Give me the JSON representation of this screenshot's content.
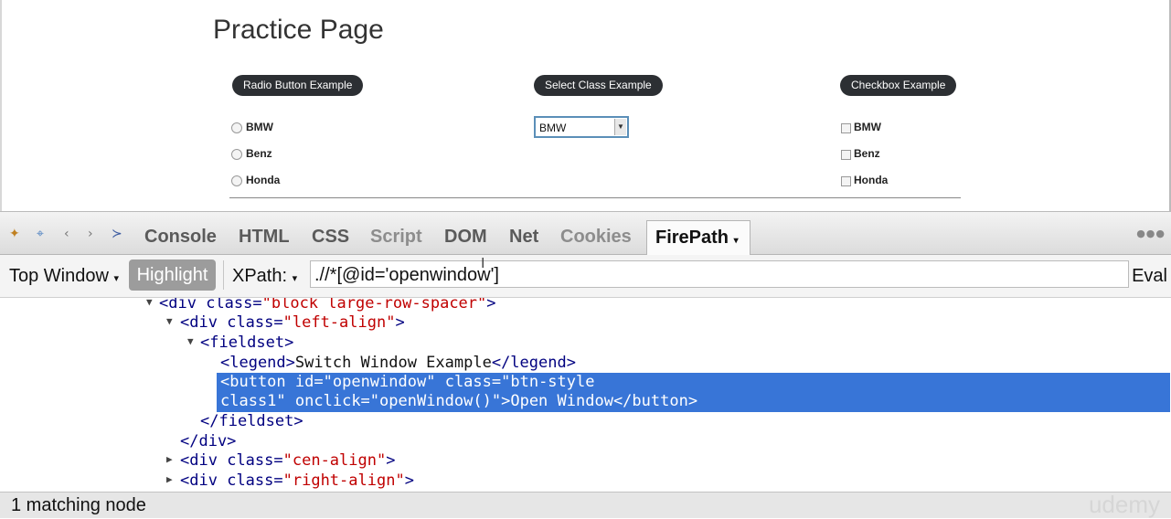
{
  "page": {
    "title": "Practice Page",
    "radio": {
      "label": "Radio Button Example",
      "options": [
        "BMW",
        "Benz",
        "Honda"
      ]
    },
    "select": {
      "label": "Select Class Example",
      "value": "BMW"
    },
    "checkbox": {
      "label": "Checkbox Example",
      "options": [
        "BMW",
        "Benz",
        "Honda"
      ]
    }
  },
  "devtools": {
    "tabs": [
      "Console",
      "HTML",
      "CSS",
      "Script",
      "DOM",
      "Net",
      "Cookies",
      "FirePath"
    ],
    "active_tab": "FirePath",
    "toolbar": {
      "window_select": "Top Window",
      "highlight_label": "Highlight",
      "xpath_label": "XPath:",
      "xpath_value": ".//*[@id='openwindow']",
      "eval_label": "Eval"
    },
    "tree": {
      "l0": {
        "open": "<div",
        "attr": "class=",
        "val": "\"block large-row-spacer\"",
        "close": ">"
      },
      "l1": {
        "open": "<div",
        "attr": "class=",
        "val": "\"left-align\"",
        "close": ">"
      },
      "l2": {
        "open": "<fieldset>"
      },
      "l3": {
        "open": "<legend>",
        "text": "Switch Window Example",
        "close": "</legend>"
      },
      "l4a": {
        "open": "<button",
        "a1": "id=",
        "v1": "\"openwindow\"",
        "a2": "class=",
        "v2": "\"btn-style"
      },
      "l4b": {
        "v2": "class1\"",
        "a3": "onclick=",
        "v3": "\"openWindow()\"",
        "close1": ">",
        "text": "Open Window",
        "close2": "</button>"
      },
      "l5": {
        "open": "</fieldset>"
      },
      "l6": {
        "open": "</div>"
      },
      "l7": {
        "open": "<div",
        "attr": "class=",
        "val": "\"cen-align\"",
        "close": ">"
      },
      "l8": {
        "open": "<div",
        "attr": "class=",
        "val": "\"right-align\"",
        "close": ">"
      }
    },
    "status": "1 matching node",
    "watermark": "udemy"
  }
}
